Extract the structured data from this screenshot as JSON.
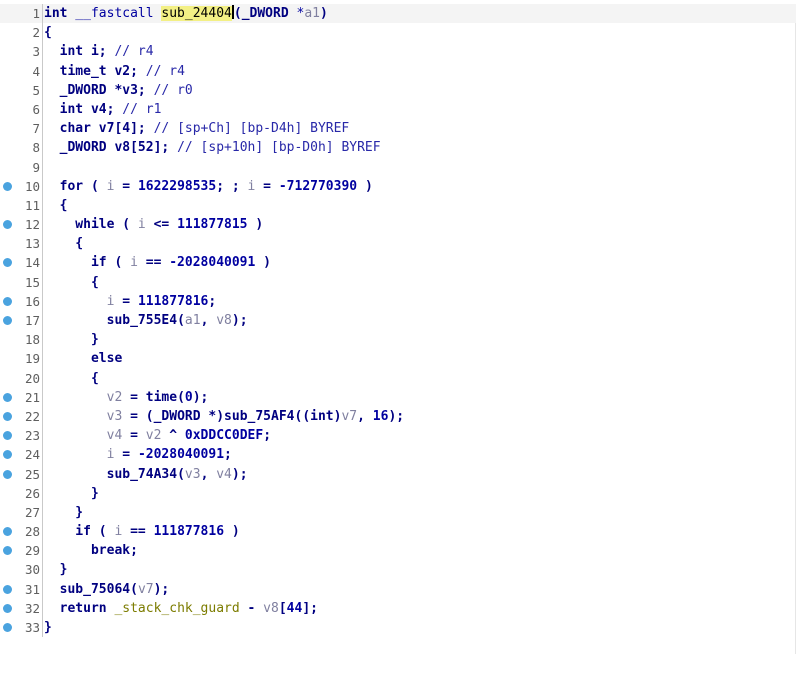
{
  "editor": {
    "lines": [
      {
        "num": "1",
        "bp": false,
        "html_id": "l1"
      },
      {
        "num": "2",
        "bp": false,
        "html_id": "l2"
      },
      {
        "num": "3",
        "bp": false,
        "html_id": "l3"
      },
      {
        "num": "4",
        "bp": false,
        "html_id": "l4"
      },
      {
        "num": "5",
        "bp": false,
        "html_id": "l5"
      },
      {
        "num": "6",
        "bp": false,
        "html_id": "l6"
      },
      {
        "num": "7",
        "bp": false,
        "html_id": "l7"
      },
      {
        "num": "8",
        "bp": false,
        "html_id": "l8"
      },
      {
        "num": "9",
        "bp": false,
        "html_id": "l9"
      },
      {
        "num": "10",
        "bp": true,
        "html_id": "l10"
      },
      {
        "num": "11",
        "bp": false,
        "html_id": "l11"
      },
      {
        "num": "12",
        "bp": true,
        "html_id": "l12"
      },
      {
        "num": "13",
        "bp": false,
        "html_id": "l13"
      },
      {
        "num": "14",
        "bp": true,
        "html_id": "l14"
      },
      {
        "num": "15",
        "bp": false,
        "html_id": "l15"
      },
      {
        "num": "16",
        "bp": true,
        "html_id": "l16"
      },
      {
        "num": "17",
        "bp": true,
        "html_id": "l17"
      },
      {
        "num": "18",
        "bp": false,
        "html_id": "l18"
      },
      {
        "num": "19",
        "bp": false,
        "html_id": "l19"
      },
      {
        "num": "20",
        "bp": false,
        "html_id": "l20"
      },
      {
        "num": "21",
        "bp": true,
        "html_id": "l21"
      },
      {
        "num": "22",
        "bp": true,
        "html_id": "l22"
      },
      {
        "num": "23",
        "bp": true,
        "html_id": "l23"
      },
      {
        "num": "24",
        "bp": true,
        "html_id": "l24"
      },
      {
        "num": "25",
        "bp": true,
        "html_id": "l25"
      },
      {
        "num": "26",
        "bp": false,
        "html_id": "l26"
      },
      {
        "num": "27",
        "bp": false,
        "html_id": "l27"
      },
      {
        "num": "28",
        "bp": true,
        "html_id": "l28"
      },
      {
        "num": "29",
        "bp": true,
        "html_id": "l29"
      },
      {
        "num": "30",
        "bp": false,
        "html_id": "l30"
      },
      {
        "num": "31",
        "bp": true,
        "html_id": "l31"
      },
      {
        "num": "32",
        "bp": true,
        "html_id": "l32"
      },
      {
        "num": "33",
        "bp": true,
        "html_id": "l33"
      }
    ],
    "tokens": {
      "l1": [
        "int",
        " __fastcall ",
        "sub_24404",
        "(",
        "_DWORD",
        " *",
        "a1",
        ")"
      ],
      "l2": [
        "{"
      ],
      "l3": [
        "  ",
        "int",
        " i; ",
        "// r4"
      ],
      "l4": [
        "  ",
        "time_t",
        " v2; ",
        "// r4"
      ],
      "l5": [
        "  ",
        "_DWORD",
        " *v3; ",
        "// r0"
      ],
      "l6": [
        "  ",
        "int",
        " v4; ",
        "// r1"
      ],
      "l7": [
        "  ",
        "char",
        " v7[4]; ",
        "// [sp+Ch] [bp-D4h] BYREF"
      ],
      "l8": [
        "  ",
        "_DWORD",
        " v8[52]; ",
        "// [sp+10h] [bp-D0h] BYREF"
      ],
      "l9": [
        ""
      ],
      "l10": [
        "  for ( ",
        "i",
        " = ",
        "1622298535",
        "; ; ",
        "i",
        " = ",
        "-712770390",
        " )"
      ],
      "l11": [
        "  {"
      ],
      "l12": [
        "    while ( ",
        "i",
        " <= ",
        "111877815",
        " )"
      ],
      "l13": [
        "    {"
      ],
      "l14": [
        "      if ( ",
        "i",
        " == ",
        "-2028040091",
        " )"
      ],
      "l15": [
        "      {"
      ],
      "l16": [
        "        ",
        "i",
        " = ",
        "111877816",
        ";"
      ],
      "l17": [
        "        ",
        "sub_755E4",
        "(",
        "a1",
        ", ",
        "v8",
        ");"
      ],
      "l18": [
        "      }"
      ],
      "l19": [
        "      else"
      ],
      "l20": [
        "      {"
      ],
      "l21": [
        "        ",
        "v2",
        " = ",
        "time",
        "(",
        "0",
        ");"
      ],
      "l22": [
        "        ",
        "v3",
        " = (",
        "_DWORD",
        " *)",
        "sub_75AF4",
        "((",
        "int",
        ")",
        "v7",
        ", ",
        "16",
        ");"
      ],
      "l23": [
        "        ",
        "v4",
        " = ",
        "v2",
        " ^ ",
        "0xDDCC0DEF",
        ";"
      ],
      "l24": [
        "        ",
        "i",
        " = ",
        "-2028040091",
        ";"
      ],
      "l25": [
        "        ",
        "sub_74A34",
        "(",
        "v3",
        ", ",
        "v4",
        ");"
      ],
      "l26": [
        "      }"
      ],
      "l27": [
        "    }"
      ],
      "l28": [
        "    if ( ",
        "i",
        " == ",
        "111877816",
        " )"
      ],
      "l29": [
        "      break;"
      ],
      "l30": [
        "  }"
      ],
      "l31": [
        "  ",
        "sub_75064",
        "(",
        "v7",
        ");"
      ],
      "l32": [
        "  return ",
        "_stack_chk_guard",
        " - ",
        "v8",
        "[",
        "44",
        "];"
      ],
      "l33": [
        "}"
      ]
    },
    "styles": {
      "l1": [
        "t",
        "v",
        "hl",
        "k",
        "t",
        "v",
        "var",
        "k"
      ],
      "l2": [
        "k"
      ],
      "l3": [
        "",
        "t",
        "k",
        "c"
      ],
      "l4": [
        "",
        "t",
        "k",
        "c"
      ],
      "l5": [
        "",
        "t",
        "k",
        "c"
      ],
      "l6": [
        "",
        "t",
        "k",
        "c"
      ],
      "l7": [
        "",
        "t",
        "k",
        "c"
      ],
      "l8": [
        "",
        "t",
        "k",
        "c"
      ],
      "l9": [
        ""
      ],
      "l10": [
        "k",
        "var",
        "k",
        "n",
        "k",
        "var",
        "k",
        "n",
        "k"
      ],
      "l11": [
        "k"
      ],
      "l12": [
        "k",
        "var",
        "k",
        "n",
        "k"
      ],
      "l13": [
        "k"
      ],
      "l14": [
        "k",
        "var",
        "k",
        "n",
        "k"
      ],
      "l15": [
        "k"
      ],
      "l16": [
        "",
        "var",
        "k",
        "n",
        "k"
      ],
      "l17": [
        "",
        "k",
        "k",
        "var",
        "k",
        "var",
        "k"
      ],
      "l18": [
        "k"
      ],
      "l19": [
        "k"
      ],
      "l20": [
        "k"
      ],
      "l21": [
        "",
        "var",
        "k",
        "k",
        "k",
        "n",
        "k"
      ],
      "l22": [
        "",
        "var",
        "k",
        "t",
        "k",
        "k",
        "k",
        "t",
        "k",
        "var",
        "k",
        "n",
        "k"
      ],
      "l23": [
        "",
        "var",
        "k",
        "var",
        "k",
        "n",
        "k"
      ],
      "l24": [
        "",
        "var",
        "k",
        "n",
        "k"
      ],
      "l25": [
        "",
        "k",
        "k",
        "var",
        "k",
        "var",
        "k"
      ],
      "l26": [
        "k"
      ],
      "l27": [
        "k"
      ],
      "l28": [
        "k",
        "var",
        "k",
        "n",
        "k"
      ],
      "l29": [
        "k"
      ],
      "l30": [
        "k"
      ],
      "l31": [
        "",
        "k",
        "k",
        "var",
        "k"
      ],
      "l32": [
        "k",
        "g",
        "k",
        "var",
        "k",
        "n",
        "k"
      ],
      "l33": [
        "k"
      ]
    },
    "colors": {
      "breakpoint": "#4aa3df",
      "highlight": "#f3f085",
      "keyword": "#000080",
      "comment": "#2828a8",
      "local_var": "#8080a0",
      "global": "#7c7c00"
    }
  }
}
